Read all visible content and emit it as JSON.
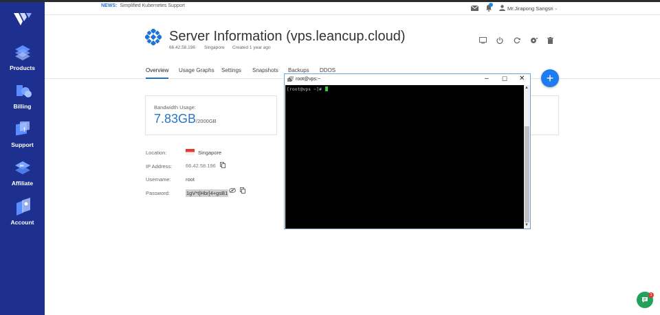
{
  "sidebar": {
    "items": [
      {
        "label": "Products",
        "icon": "stack-icon"
      },
      {
        "label": "Billing",
        "icon": "billing-icon"
      },
      {
        "label": "Support",
        "icon": "support-icon"
      },
      {
        "label": "Affiliate",
        "icon": "affiliate-icon"
      },
      {
        "label": "Account",
        "icon": "account-icon"
      }
    ]
  },
  "topbar": {
    "news_label": "NEWS:",
    "news_text": "Simplified Kubernetes Support",
    "user_name": "Mr.Jirapong Sangsri"
  },
  "header": {
    "title": "Server Information (vps.leancup.cloud)",
    "ip": "66.42.58.196",
    "region": "Singapore",
    "created": "Created 1 year ago"
  },
  "tabs": [
    "Overview",
    "Usage Graphs",
    "Settings",
    "Snapshots",
    "Backups",
    "DDOS"
  ],
  "bandwidth": {
    "label": "Bandwidth Usage:",
    "value": "7.83GB",
    "total": "/2000GB"
  },
  "details": {
    "location_label": "Location:",
    "location_value": "Singapore",
    "ip_label": "IP Address:",
    "ip_value": "66.42.58.196",
    "username_label": "Username:",
    "username_value": "root",
    "password_label": "Password:",
    "password_value": "1gV*t[Hbr]4+gsB1"
  },
  "terminal": {
    "title": "root@vps:~",
    "prompt": "[root@vps ~]# "
  },
  "fab_label": "+",
  "chat_badge": "1",
  "colors": {
    "sidebar": "#1d2f8f",
    "accent": "#1e7bf0",
    "chat": "#21a15a"
  }
}
